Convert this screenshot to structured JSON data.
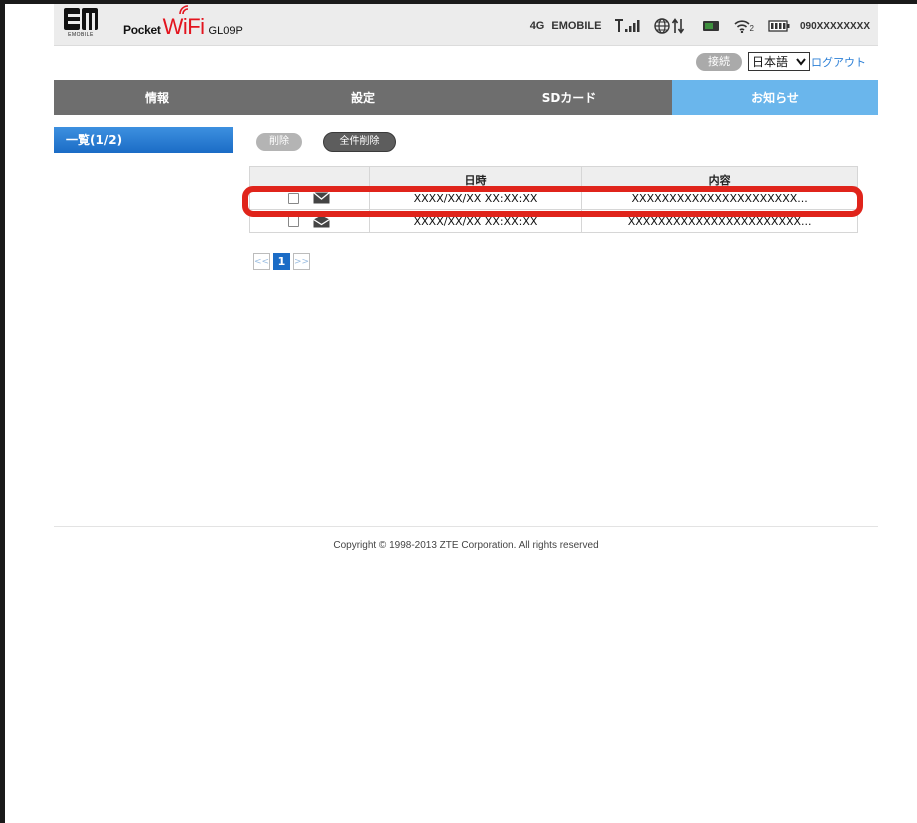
{
  "header": {
    "logo_small_text": "EMOBILE",
    "brand_pocket": "Pocket",
    "brand_wifi": "WiFi",
    "brand_model": "GL09P",
    "status": {
      "network_type": "4G",
      "carrier": "EMOBILE",
      "wifi_clients": "2",
      "phone_number": "090XXXXXXXX"
    }
  },
  "toolbar": {
    "connect_label": "接続",
    "language_value": "日本語",
    "logout_label": "ログアウト"
  },
  "nav": {
    "tabs": [
      {
        "label": "情報"
      },
      {
        "label": "設定"
      },
      {
        "label": "SDカード"
      },
      {
        "label": "お知らせ"
      }
    ],
    "active_tab": "お知らせ"
  },
  "sidebar": {
    "items": [
      {
        "label": "一覧(1/2)"
      }
    ]
  },
  "actions": {
    "delete_label": "削除",
    "delete_all_label": "全件削除"
  },
  "table": {
    "columns": [
      "",
      "日時",
      "内容"
    ],
    "rows": [
      {
        "read": false,
        "datetime": "XXXX/XX/XX XX:XX:XX",
        "content": "XXXXXXXXXXXXXXXXXXXXXX..."
      },
      {
        "read": true,
        "datetime": "XXXX/XX/XX XX:XX:XX",
        "content": "XXXXXXXXXXXXXXXXXXXXXXX..."
      }
    ]
  },
  "pagination": {
    "prev": "<<",
    "current": "1",
    "next": ">>"
  },
  "footer": {
    "copyright": "Copyright © 1998-2013 ZTE Corporation. All rights reserved"
  },
  "colors": {
    "nav_bg": "#6e6e6e",
    "nav_active": "#6ab6ec",
    "sidebar_active": "#1b6cc6",
    "highlight": "#e0241b",
    "wifi_red": "#e3141e",
    "link_blue": "#2b7fd6"
  }
}
